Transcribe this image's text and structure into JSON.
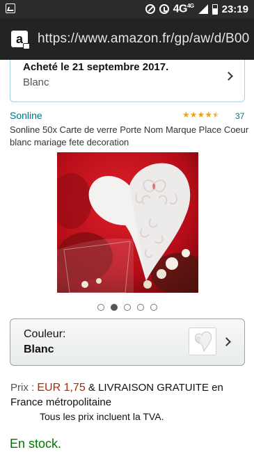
{
  "status_bar": {
    "network": "4G",
    "network_sup": "4G",
    "time": "23:19"
  },
  "browser": {
    "url": "https://www.amazon.fr/gp/aw/d/B00"
  },
  "purchase_notice": {
    "title": "Acheté le 21 septembre 2017.",
    "variant": "Blanc"
  },
  "product": {
    "brand": "Sonline",
    "rating_stars": 4.5,
    "rating_count": "37",
    "title": "Sonline 50x Carte de verre Porte Nom Marque Place Coeur blanc mariage fete decoration",
    "image_count": 5,
    "active_image": 1
  },
  "color": {
    "label": "Couleur:",
    "value": "Blanc"
  },
  "price": {
    "label": "Prix :",
    "amount": "EUR 1,75",
    "shipping": "& LIVRAISON GRATUITE en France métropolitaine",
    "tax_note": "Tous les prix incluent la TVA."
  },
  "availability": "En stock.",
  "colors": {
    "link": "#007185",
    "price": "#B12704",
    "in_stock": "#007600",
    "star": "#f0a10c"
  }
}
